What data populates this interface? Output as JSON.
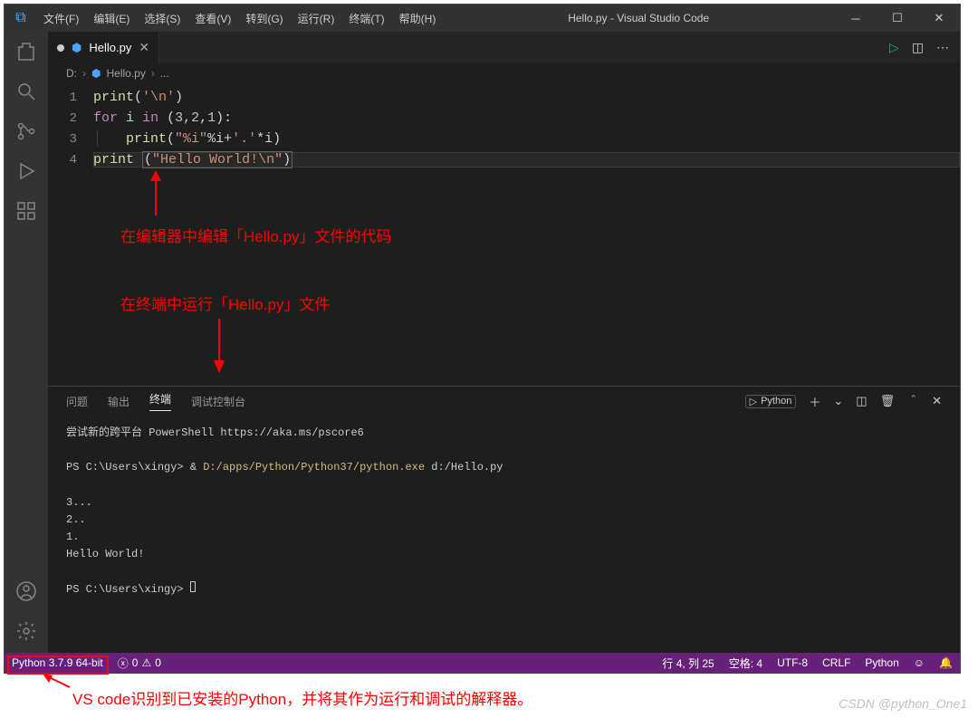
{
  "titlebar": {
    "menus": [
      "文件(F)",
      "编辑(E)",
      "选择(S)",
      "查看(V)",
      "转到(G)",
      "运行(R)",
      "终端(T)",
      "帮助(H)"
    ],
    "title": "Hello.py - Visual Studio Code"
  },
  "tab": {
    "filename": "Hello.py"
  },
  "breadcrumb": {
    "drive": "D:",
    "file": "Hello.py",
    "tail": "..."
  },
  "code": {
    "l1": {
      "fn": "print",
      "s": "'\\n'"
    },
    "l2": {
      "kw1": "for",
      "id": "i",
      "kw2": "in",
      "nums": [
        "3",
        "2",
        "1"
      ]
    },
    "l3": {
      "fn": "print",
      "s1": "\"%i\"",
      "op": "%i+",
      "s2": "'.'",
      "op2": "*i"
    },
    "l4": {
      "fn": "print",
      "s": "\"Hello World!\\n\""
    }
  },
  "annotations": {
    "a1": "在编辑器中编辑「Hello.py」文件的代码",
    "a2": "在终端中运行「Hello.py」文件",
    "a3": "VS code识别到已安装的Python，并将其作为运行和调试的解释器。"
  },
  "panel": {
    "tabs": [
      "问题",
      "输出",
      "终端",
      "调试控制台"
    ],
    "runner": "Python"
  },
  "terminal": {
    "l1": "尝试新的跨平台 PowerShell https://aka.ms/pscore6",
    "l2p": "PS C:\\Users\\xingy> ",
    "l2cmd": "& ",
    "l2path": "D:/apps/Python/Python37/python.exe",
    "l2args": " d:/Hello.py",
    "out": [
      "3...",
      "2..",
      "1.",
      "Hello World!"
    ],
    "prompt2": "PS C:\\Users\\xingy> "
  },
  "status": {
    "python": "Python 3.7.9 64-bit",
    "errors": "0",
    "warnings": "0",
    "line": "行 4, 列 25",
    "spaces": "空格: 4",
    "enc": "UTF-8",
    "eol": "CRLF",
    "lang": "Python"
  },
  "watermark": "CSDN @python_One1"
}
